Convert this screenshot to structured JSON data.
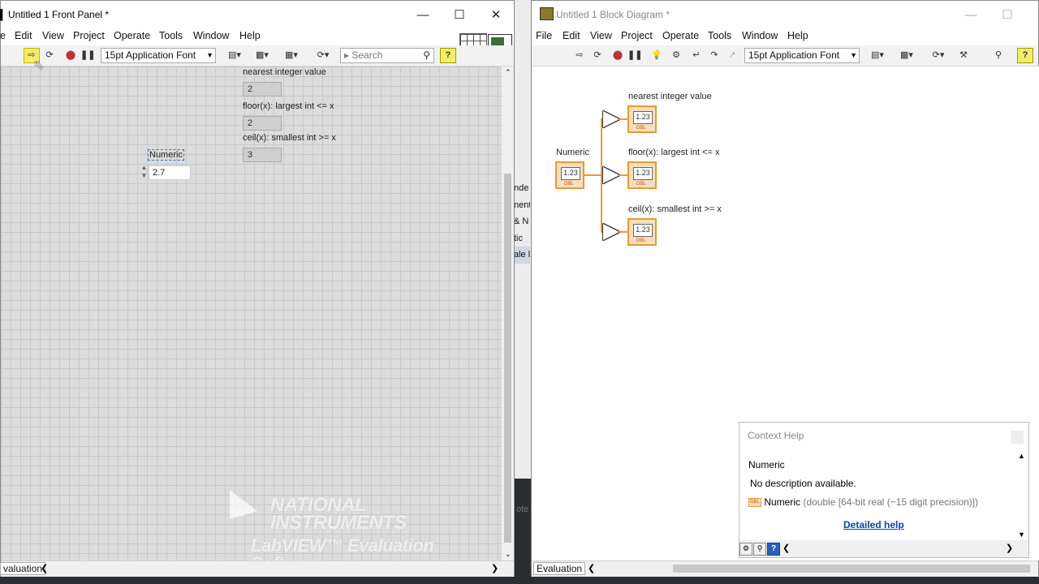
{
  "front_panel": {
    "title": "Untitled 1 Front Panel *",
    "menu": [
      "e",
      "Edit",
      "View",
      "Project",
      "Operate",
      "Tools",
      "Window",
      "Help"
    ],
    "font_dropdown": "15pt Application Font",
    "search_placeholder": "Search",
    "indicators": [
      {
        "label": "nearest integer value",
        "value": "2"
      },
      {
        "label": "floor(x): largest int <= x",
        "value": "2"
      },
      {
        "label": "ceil(x): smallest int >= x",
        "value": "3"
      }
    ],
    "control": {
      "label": "Numeric",
      "value": "2.7"
    },
    "status_tab": "valuation",
    "watermark_line1": "NATIONAL",
    "watermark_line2": "INSTRUMENTS",
    "watermark_line3": "LabVIEW™ Evaluation Software"
  },
  "block_diagram": {
    "title": "Untitled 1 Block Diagram *",
    "menu": [
      "File",
      "Edit",
      "View",
      "Project",
      "Operate",
      "Tools",
      "Window",
      "Help"
    ],
    "font_dropdown": "15pt Application Font",
    "control_label": "Numeric",
    "indicator_labels": [
      "nearest integer value",
      "floor(x): largest int <= x",
      "ceil(x): smallest int >= x"
    ],
    "terminal_text": "1.23",
    "terminal_type": "DBL",
    "status_tab": "Evaluation"
  },
  "context_help": {
    "title": "Context Help",
    "heading": "Numeric",
    "description": "No description available.",
    "type_name": "Numeric",
    "type_detail": "(double [64-bit real (~15 digit precision)])",
    "link": "Detailed help"
  },
  "background": {
    "peek_items": [
      "nde",
      "nent",
      "& N",
      "tic",
      "ale l"
    ],
    "peek_text": "ote"
  },
  "colors": {
    "wire": "#e79a34",
    "link": "#0645ad",
    "run_highlight": "#f3ec6a"
  }
}
